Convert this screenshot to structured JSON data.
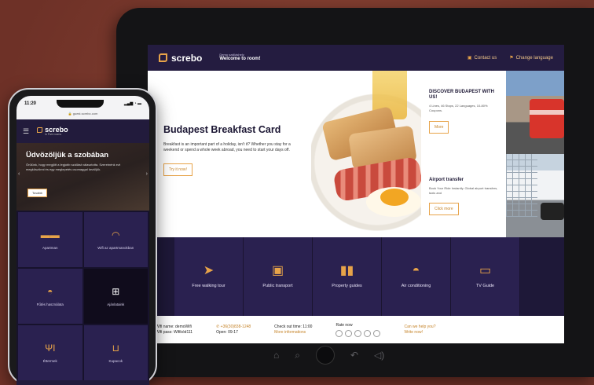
{
  "tablet": {
    "header": {
      "logo": "screbo",
      "small_text": "Demo szálláshely",
      "welcome": "Welcome to room!",
      "contact": "Contact us",
      "language": "Change language"
    },
    "hero": {
      "title": "Budapest Breakfast Card",
      "description": "Breakfast is an important part of a holiday, isn't it? Whether you stay for a weekend or spend a whole week abroad, you need to start your days off.",
      "button": "Try it now!"
    },
    "cards": [
      {
        "title": "DISCOVER BUDAPEST WITH US!",
        "description": "4 Lines, 46 Stops, 22 Languages, 10-80% Coupons.",
        "button": "More"
      },
      {
        "title": "Airport transfer",
        "description": "Book Your Ride Instantly. Global airport transfers, taxis and",
        "button": "Click more"
      }
    ],
    "tiles": [
      {
        "label": "Free walking tour",
        "icon": "cursor-icon"
      },
      {
        "label": "Public transport",
        "icon": "bus-icon"
      },
      {
        "label": "Property guides",
        "icon": "book-icon"
      },
      {
        "label": "Air conditioning",
        "icon": "fan-icon"
      },
      {
        "label": "TV Guide",
        "icon": "tv-icon"
      }
    ],
    "footer": {
      "wifi_name": "Wifi name: demoWifi",
      "wifi_pass": "Wifi pass: Wifikód111",
      "phone": "+36(30)838-1248",
      "open": "Open: 09-17",
      "checkout": "Check out time: 11:00",
      "more_info": "More informations",
      "rate": "Rate now",
      "help": "Can we help you?",
      "write": "Write now!"
    }
  },
  "phone": {
    "time": "11:20",
    "url": "guest.screbo.com",
    "logo": "screbo",
    "logo_sub": "in Five rooms",
    "hero": {
      "title": "Üdvözöljük a szobában",
      "description": "Örülünk, hogy megjött a legjobb szállást választotta. Szeretnénk ezt megköszönni és egy meglepetés csomaggal kezüljük.",
      "button": "Tovább"
    },
    "tiles": [
      {
        "label": "Apartman",
        "icon": "bed-icon"
      },
      {
        "label": "Wifi az apartmanokban",
        "icon": "wifi-icon"
      },
      {
        "label": "Fűtés használata",
        "icon": "heater-icon"
      },
      {
        "label": "Ajánlataink",
        "icon": "gift-icon"
      },
      {
        "label": "Éttermek",
        "icon": "fork-icon"
      },
      {
        "label": "Kupacok",
        "icon": "bath-icon"
      }
    ]
  },
  "colors": {
    "accent": "#e7a349",
    "brand_dark": "#221b3c",
    "background": "#7a3a2e"
  }
}
